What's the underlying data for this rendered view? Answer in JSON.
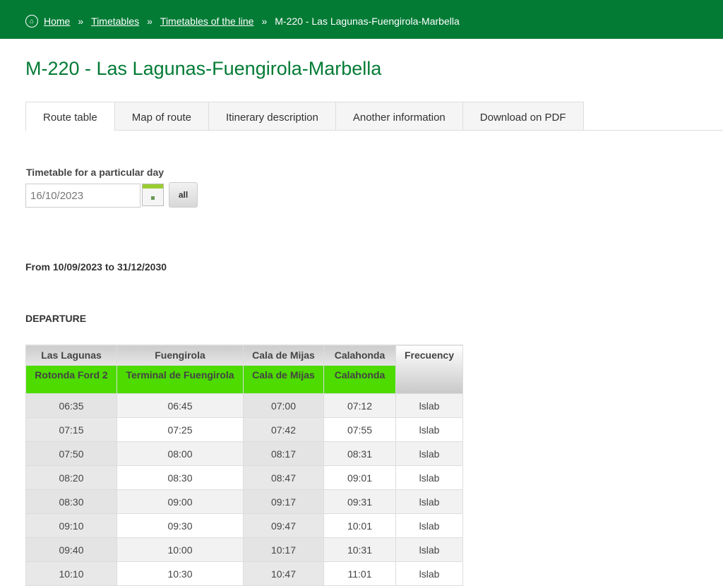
{
  "breadcrumb": {
    "items": [
      "Home",
      "Timetables",
      "Timetables of the line"
    ],
    "current": "M-220 - Las Lagunas-Fuengirola-Marbella",
    "separator": "»"
  },
  "page_title": "M-220 - Las Lagunas-Fuengirola-Marbella",
  "tabs": [
    "Route table",
    "Map of route",
    "Itinerary description",
    "Another information",
    "Download on PDF"
  ],
  "day_filter": {
    "label": "Timetable for a particular day",
    "date_value": "16/10/2023",
    "all_label": "all"
  },
  "period": "From 10/09/2023 to 31/12/2030",
  "direction": "DEPARTURE",
  "table": {
    "headers": [
      "Las Lagunas",
      "Fuengirola",
      "Cala de Mijas",
      "Calahonda",
      "Frecuency"
    ],
    "stops": [
      "Rotonda Ford 2",
      "Terminal de Fuengirola",
      "Cala de Mijas",
      "Calahonda"
    ],
    "rows": [
      [
        "06:35",
        "06:45",
        "07:00",
        "07:12",
        "lslab"
      ],
      [
        "07:15",
        "07:25",
        "07:42",
        "07:55",
        "lslab"
      ],
      [
        "07:50",
        "08:00",
        "08:17",
        "08:31",
        "lslab"
      ],
      [
        "08:20",
        "08:30",
        "08:47",
        "09:01",
        "lslab"
      ],
      [
        "08:30",
        "09:00",
        "09:17",
        "09:31",
        "lslab"
      ],
      [
        "09:10",
        "09:30",
        "09:47",
        "10:01",
        "lslab"
      ],
      [
        "09:40",
        "10:00",
        "10:17",
        "10:31",
        "lslab"
      ],
      [
        "10:10",
        "10:30",
        "10:47",
        "11:01",
        "lslab"
      ]
    ]
  },
  "colors": {
    "brand": "#037b35",
    "stop_header": "#4ddb00"
  }
}
